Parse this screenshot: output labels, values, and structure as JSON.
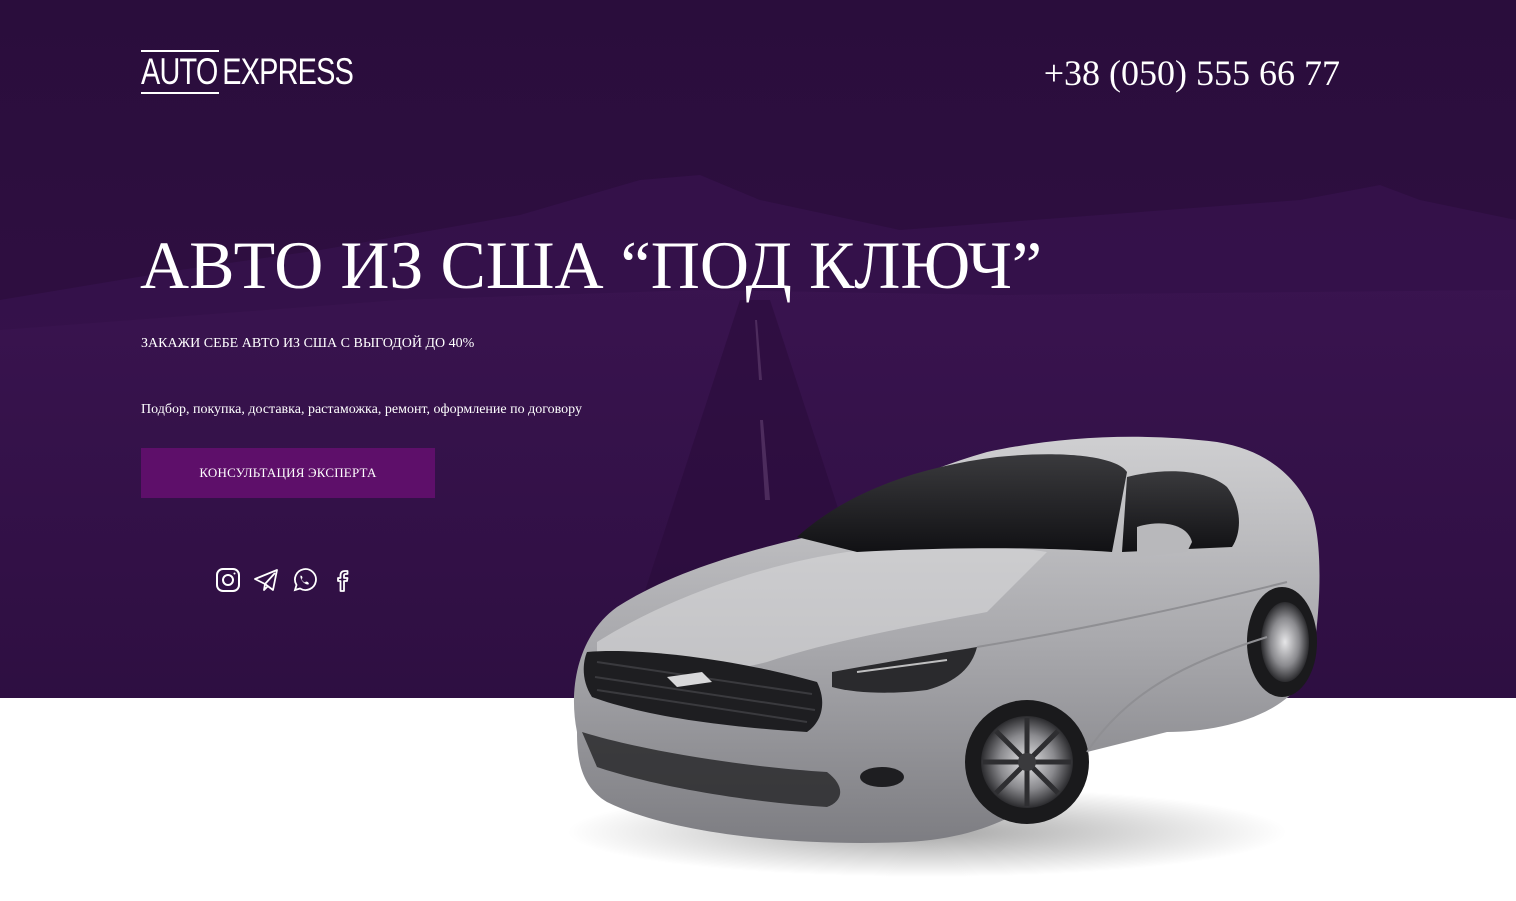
{
  "header": {
    "logo_word1": "AUTO",
    "logo_word2": "EXPRESS",
    "phone": "+38 (050) 555 66 77"
  },
  "hero": {
    "title": "АВТО ИЗ США “ПОД КЛЮЧ”",
    "subtitle": "ЗАКАЖИ СЕБЕ АВТО ИЗ США С ВЫГОДОЙ ДО 40%",
    "description": "Подбор, покупка, доставка, растаможка, ремонт, оформление по договору",
    "cta_label": "КОНСУЛЬТАЦИЯ ЭКСПЕРТА"
  },
  "socials": [
    {
      "icon": "instagram-icon"
    },
    {
      "icon": "telegram-icon"
    },
    {
      "icon": "whatsapp-icon"
    },
    {
      "icon": "facebook-icon"
    }
  ],
  "colors": {
    "hero_background": "#2e0f42",
    "button": "#5e0f6a",
    "text": "#ffffff"
  }
}
